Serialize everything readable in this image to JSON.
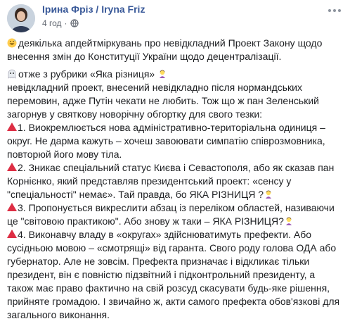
{
  "post": {
    "author": "Ірина Фріз / Iryna Friz",
    "time": "4 год",
    "privacy_icon": "globe-icon",
    "more_icon": "more-dots-icon",
    "intro": [
      "деякілька апдейтміркувань про невідкладний Проект Закону щодо",
      "внесення змін до Конституції України щодо децентралізації."
    ],
    "section_header": "отже з рубрики «Яка різниця»",
    "lead_lines": [
      "невідкладний проект, внесений невідкладно після нормандських",
      "перемовин, адже Путін чекати не любить. Тож що ж пан Зеленський",
      "загорнув у святкову новорічну обгортку для свого тезки:"
    ],
    "points": [
      {
        "lines": [
          "1. Виокремлюється нова адміністративно-територіальна одиниця –",
          "округ. Не дарма кажуть – хочеш завоювати симпатію співрозмовника,",
          "повторюй його мову тіла."
        ],
        "emoji_end": false
      },
      {
        "lines": [
          "2. Зникає спеціальний статус Києва і Севастополя, або як сказав пан",
          "Корнієнко, який представляв президентський проект: «сенсу у",
          "\"спеціальності\" немає». Тай правда, бо ЯКА РІЗНИЦЯ ?"
        ],
        "emoji_end": true
      },
      {
        "lines": [
          "3. Пропонується викреслити абзац із переліком областей, називаючи",
          "це \"світовою практикою\". Або знову ж таки – ЯКА РІЗНИЦЯ?"
        ],
        "emoji_end": true
      },
      {
        "lines": [
          "4. Виконавчу владу в «округах» здійснюватимуть префекти. Або",
          "сусідньою мовою – «смотрящі» від гаранта. Свого роду голова ОДА або",
          "губернатор. Але не зовсім. Префекта призначає і відкликає тільки",
          "президент, він є повністю підзвітний і підконтрольний президенту, а",
          "також має право фактично на свій розсуд скасувати будь-яке рішення,",
          "прийняте громадою. І звичайно ж, акти самого префекта обов'язкові для",
          "загального виконання."
        ],
        "emoji_end": false
      }
    ],
    "colors": {
      "author_link": "#385898",
      "meta_gray": "#616770",
      "red_triangle": "#dd2e44"
    }
  }
}
